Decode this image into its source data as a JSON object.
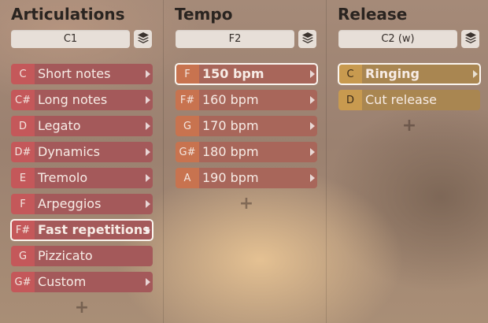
{
  "columns": [
    {
      "title": "Articulations",
      "key": "C1",
      "items": [
        {
          "note": "C",
          "label": "Short notes",
          "selected": false
        },
        {
          "note": "C#",
          "label": "Long notes",
          "selected": false
        },
        {
          "note": "D",
          "label": "Legato",
          "selected": false
        },
        {
          "note": "D#",
          "label": "Dynamics",
          "selected": false
        },
        {
          "note": "E",
          "label": "Tremolo",
          "selected": false
        },
        {
          "note": "F",
          "label": "Arpeggios",
          "selected": false
        },
        {
          "note": "F#",
          "label": "Fast repetitions",
          "selected": true
        },
        {
          "note": "G",
          "label": "Pizzicato",
          "selected": false
        },
        {
          "note": "G#",
          "label": "Custom",
          "selected": false
        }
      ],
      "add_label": "+"
    },
    {
      "title": "Tempo",
      "key": "F2",
      "items": [
        {
          "note": "F",
          "label": "150 bpm",
          "selected": true
        },
        {
          "note": "F#",
          "label": "160 bpm",
          "selected": false
        },
        {
          "note": "G",
          "label": "170 bpm",
          "selected": false
        },
        {
          "note": "G#",
          "label": "180 bpm",
          "selected": false
        },
        {
          "note": "A",
          "label": "190 bpm",
          "selected": false
        }
      ],
      "add_label": "+"
    },
    {
      "title": "Release",
      "key": "C2 (w)",
      "items": [
        {
          "note": "C",
          "label": "Ringing",
          "selected": true
        },
        {
          "note": "D",
          "label": "Cut release",
          "selected": false
        }
      ],
      "add_label": "+"
    }
  ],
  "icons": {
    "layers": "layers-icon",
    "row_arrow": "chevron-right-icon",
    "add": "plus-icon"
  },
  "colors": {
    "articulation_note": "#c4585a",
    "articulation_label": "#a4595a",
    "tempo_note": "#c8734f",
    "tempo_label": "#a8665a",
    "release_note": "#c89a4f",
    "release_label": "#a98651",
    "selected_outline": "#fbf5ef"
  }
}
